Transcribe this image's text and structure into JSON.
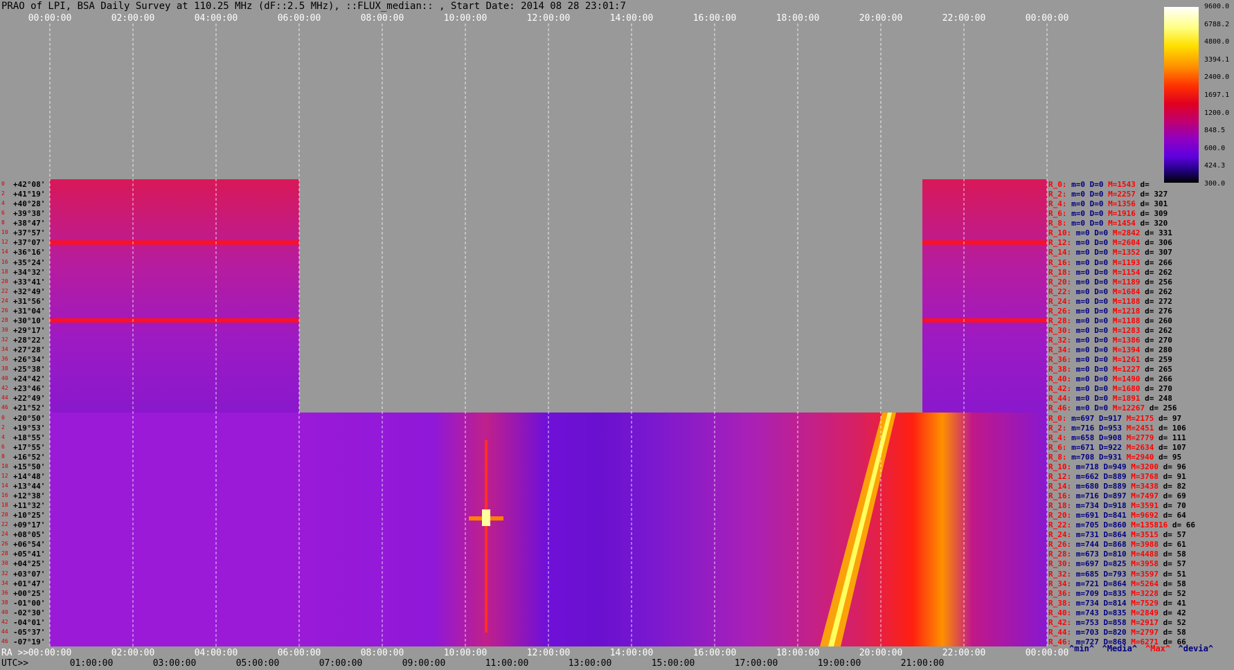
{
  "title": "PRAO of LPI, BSA Daily Survey at 110.25 MHz (dF::2.5 MHz), ::FLUX_median:: , Start Date: 2014 08 28 23:01:7",
  "ra_axis_prefix": "RA >>",
  "utc_axis_prefix": "UTC>>",
  "ra_ticks_top": [
    "00:00:00",
    "02:00:00",
    "04:00:00",
    "06:00:00",
    "08:00:00",
    "10:00:00",
    "12:00:00",
    "14:00:00",
    "16:00:00",
    "18:00:00",
    "20:00:00",
    "22:00:00",
    "00:00:00"
  ],
  "ra_ticks_bottom": [
    "00:00:00",
    "02:00:00",
    "04:00:00",
    "06:00:00",
    "08:00:00",
    "10:00:00",
    "12:00:00",
    "14:00:00",
    "16:00:00",
    "18:00:00",
    "20:00:00",
    "22:00:00",
    "00:00:00"
  ],
  "utc_ticks": [
    "01:00:00",
    "03:00:00",
    "05:00:00",
    "07:00:00",
    "09:00:00",
    "11:00:00",
    "13:00:00",
    "15:00:00",
    "17:00:00",
    "19:00:00",
    "21:00:00"
  ],
  "colorbar": {
    "labels": [
      "9600.0",
      "6788.2",
      "4800.0",
      "3394.1",
      "2400.0",
      "1697.1",
      "1200.0",
      "848.5",
      "600.0",
      "424.3",
      "300.0"
    ],
    "colors": [
      "#ffffff",
      "#ffff80",
      "#ffe000",
      "#ff9000",
      "#ff3000",
      "#e00020",
      "#c00070",
      "#9000c0",
      "#6000e0",
      "#200080",
      "#000000"
    ]
  },
  "legend_footer": [
    {
      "text": "^min^",
      "color": "#000080"
    },
    {
      "text": "^Media^",
      "color": "#000080"
    },
    {
      "text": "^Max^",
      "color": "#ff0000"
    },
    {
      "text": "^devia^",
      "color": "#000080"
    }
  ],
  "declination_labels": [
    "+42°08'",
    "+41°19'",
    "+40°28'",
    "+39°38'",
    "+38°47'",
    "+37°57'",
    "+37°07'",
    "+36°16'",
    "+35°24'",
    "+34°32'",
    "+33°41'",
    "+32°49'",
    "+31°56'",
    "+31°04'",
    "+30°10'",
    "+29°17'",
    "+28°22'",
    "+27°28'",
    "+26°34'",
    "+25°38'",
    "+24°42'",
    "+23°46'",
    "+22°49'",
    "+21°52'",
    "+20°50'",
    "+19°53'",
    "+18°55'",
    "+17°55'",
    "+16°52'",
    "+15°50'",
    "+14°48'",
    "+13°44'",
    "+12°38'",
    "+11°32'",
    "+10°25'",
    "+09°17'",
    "+08°05'",
    "+06°54'",
    "+05°41'",
    "+04°25'",
    "+03°07'",
    "+01°47'",
    "+00°25'",
    "-01°00'",
    "-02°30'",
    "-04°01'",
    "-05°37'",
    "-07°19'"
  ],
  "beam_indices": [
    "0",
    "2",
    "4",
    "6",
    "8",
    "10",
    "12",
    "14",
    "16",
    "18",
    "20",
    "22",
    "24",
    "26",
    "28",
    "30",
    "32",
    "34",
    "36",
    "38",
    "40",
    "42",
    "44",
    "46",
    "0",
    "2",
    "4",
    "6",
    "8",
    "10",
    "12",
    "14",
    "16",
    "18",
    "20",
    "22",
    "24",
    "26",
    "28",
    "30",
    "32",
    "34",
    "36",
    "38",
    "40",
    "42",
    "44",
    "46"
  ],
  "beam_stats": [
    {
      "label": "R_0:",
      "min": "m=0",
      "median": "D=0",
      "max": "M=1543",
      "dev": "d="
    },
    {
      "label": "R_2:",
      "min": "m=0",
      "median": "D=0",
      "max": "M=2257",
      "dev": "d= 327"
    },
    {
      "label": "R_4:",
      "min": "m=0",
      "median": "D=0",
      "max": "M=1356",
      "dev": "d= 301"
    },
    {
      "label": "R_6:",
      "min": "m=0",
      "median": "D=0",
      "max": "M=1916",
      "dev": "d= 309"
    },
    {
      "label": "R_8:",
      "min": "m=0",
      "median": "D=0",
      "max": "M=1454",
      "dev": "d= 320"
    },
    {
      "label": "R_10:",
      "min": "m=0",
      "median": "D=0",
      "max": "M=2842",
      "dev": "d= 331"
    },
    {
      "label": "R_12:",
      "min": "m=0",
      "median": "D=0",
      "max": "M=2604",
      "dev": "d= 306"
    },
    {
      "label": "R_14:",
      "min": "m=0",
      "median": "D=0",
      "max": "M=1352",
      "dev": "d= 307"
    },
    {
      "label": "R_16:",
      "min": "m=0",
      "median": "D=0",
      "max": "M=1193",
      "dev": "d= 266"
    },
    {
      "label": "R_18:",
      "min": "m=0",
      "median": "D=0",
      "max": "M=1154",
      "dev": "d= 262"
    },
    {
      "label": "R_20:",
      "min": "m=0",
      "median": "D=0",
      "max": "M=1189",
      "dev": "d= 256"
    },
    {
      "label": "R_22:",
      "min": "m=0",
      "median": "D=0",
      "max": "M=1684",
      "dev": "d= 262"
    },
    {
      "label": "R_24:",
      "min": "m=0",
      "median": "D=0",
      "max": "M=1188",
      "dev": "d= 272"
    },
    {
      "label": "R_26:",
      "min": "m=0",
      "median": "D=0",
      "max": "M=1218",
      "dev": "d= 276"
    },
    {
      "label": "R_28:",
      "min": "m=0",
      "median": "D=0",
      "max": "M=1188",
      "dev": "d= 260"
    },
    {
      "label": "R_30:",
      "min": "m=0",
      "median": "D=0",
      "max": "M=1283",
      "dev": "d= 262"
    },
    {
      "label": "R_32:",
      "min": "m=0",
      "median": "D=0",
      "max": "M=1386",
      "dev": "d= 270"
    },
    {
      "label": "R_34:",
      "min": "m=0",
      "median": "D=0",
      "max": "M=1394",
      "dev": "d= 280"
    },
    {
      "label": "R_36:",
      "min": "m=0",
      "median": "D=0",
      "max": "M=1261",
      "dev": "d= 259"
    },
    {
      "label": "R_38:",
      "min": "m=0",
      "median": "D=0",
      "max": "M=1227",
      "dev": "d= 265"
    },
    {
      "label": "R_40:",
      "min": "m=0",
      "median": "D=0",
      "max": "M=1490",
      "dev": "d= 266"
    },
    {
      "label": "R_42:",
      "min": "m=0",
      "median": "D=0",
      "max": "M=1680",
      "dev": "d= 270"
    },
    {
      "label": "R_44:",
      "min": "m=0",
      "median": "D=0",
      "max": "M=1891",
      "dev": "d= 248"
    },
    {
      "label": "R_46:",
      "min": "m=0",
      "median": "D=0",
      "max": "M=12267",
      "dev": "d= 256"
    },
    {
      "label": "R_0:",
      "min": "m=697",
      "median": "D=917",
      "max": "M=2175",
      "dev": "d= 97"
    },
    {
      "label": "R_2:",
      "min": "m=716",
      "median": "D=953",
      "max": "M=2451",
      "dev": "d= 106"
    },
    {
      "label": "R_4:",
      "min": "m=658",
      "median": "D=908",
      "max": "M=2779",
      "dev": "d= 111"
    },
    {
      "label": "R_6:",
      "min": "m=671",
      "median": "D=922",
      "max": "M=2634",
      "dev": "d= 107"
    },
    {
      "label": "R_8:",
      "min": "m=708",
      "median": "D=931",
      "max": "M=2940",
      "dev": "d= 95"
    },
    {
      "label": "R_10:",
      "min": "m=718",
      "median": "D=949",
      "max": "M=3200",
      "dev": "d= 96"
    },
    {
      "label": "R_12:",
      "min": "m=662",
      "median": "D=889",
      "max": "M=3768",
      "dev": "d= 91"
    },
    {
      "label": "R_14:",
      "min": "m=680",
      "median": "D=889",
      "max": "M=3438",
      "dev": "d= 82"
    },
    {
      "label": "R_16:",
      "min": "m=716",
      "median": "D=897",
      "max": "M=7497",
      "dev": "d= 69"
    },
    {
      "label": "R_18:",
      "min": "m=734",
      "median": "D=918",
      "max": "M=3591",
      "dev": "d= 70"
    },
    {
      "label": "R_20:",
      "min": "m=691",
      "median": "D=841",
      "max": "M=9692",
      "dev": "d= 64"
    },
    {
      "label": "R_22:",
      "min": "m=705",
      "median": "D=860",
      "max": "M=135816",
      "dev": "d= 66"
    },
    {
      "label": "R_24:",
      "min": "m=731",
      "median": "D=864",
      "max": "M=3515",
      "dev": "d= 57"
    },
    {
      "label": "R_26:",
      "min": "m=744",
      "median": "D=868",
      "max": "M=3988",
      "dev": "d= 61"
    },
    {
      "label": "R_28:",
      "min": "m=673",
      "median": "D=810",
      "max": "M=4488",
      "dev": "d= 58"
    },
    {
      "label": "R_30:",
      "min": "m=697",
      "median": "D=825",
      "max": "M=3958",
      "dev": "d= 57"
    },
    {
      "label": "R_32:",
      "min": "m=685",
      "median": "D=793",
      "max": "M=3597",
      "dev": "d= 51"
    },
    {
      "label": "R_34:",
      "min": "m=721",
      "median": "D=864",
      "max": "M=5264",
      "dev": "d= 58"
    },
    {
      "label": "R_36:",
      "min": "m=709",
      "median": "D=835",
      "max": "M=3228",
      "dev": "d= 52"
    },
    {
      "label": "R_38:",
      "min": "m=734",
      "median": "D=814",
      "max": "M=7529",
      "dev": "d= 41"
    },
    {
      "label": "R_40:",
      "min": "m=743",
      "median": "D=835",
      "max": "M=2849",
      "dev": "d= 42"
    },
    {
      "label": "R_42:",
      "min": "m=753",
      "median": "D=858",
      "max": "M=2917",
      "dev": "d= 52"
    },
    {
      "label": "R_44:",
      "min": "m=703",
      "median": "D=820",
      "max": "M=2797",
      "dev": "d= 58"
    },
    {
      "label": "R_46:",
      "min": "m=727",
      "median": "D=868",
      "max": "M=6271",
      "dev": "d= 66"
    }
  ],
  "chart_data": {
    "type": "heatmap",
    "title": "PRAO of LPI, BSA Daily Survey at 110.25 MHz (dF::2.5 MHz), ::FLUX_median:: , Start Date: 2014 08 28 23:01:7",
    "x_axis": "RA",
    "xlim": [
      "00:00:00",
      "24:00:00"
    ],
    "color_scale": "log",
    "zlim": [
      300.0,
      9600.0
    ],
    "y_labels_from": "declination_labels",
    "regions": [
      {
        "block": "upper",
        "ra_start_h": 0,
        "ra_end_h": 6,
        "dec_range": [
          "+42°08'",
          "+21°52'"
        ]
      },
      {
        "block": "upper",
        "ra_start_h": 21,
        "ra_end_h": 24,
        "dec_range": [
          "+42°08'",
          "+21°52'"
        ]
      },
      {
        "block": "lower",
        "ra_start_h": 6,
        "ra_end_h": 24,
        "dec_range": [
          "+20°50'",
          "-07°19'"
        ]
      },
      {
        "block": "lower",
        "ra_start_h": 0,
        "ra_end_h": 6,
        "dec_range": [
          "+20°50'",
          "-07°19'"
        ]
      }
    ],
    "features": [
      {
        "name": "",
        "ra_h": 19.2,
        "value": 4800
      },
      {
        "name": "",
        "ra_h": 10.5,
        "value": 9600
      }
    ],
    "grid": true
  }
}
